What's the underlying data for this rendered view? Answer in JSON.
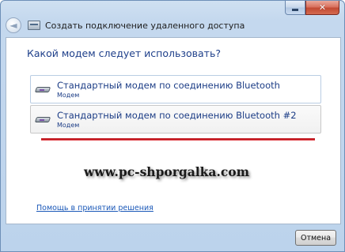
{
  "window": {
    "title": "Создать подключение удаленного доступа",
    "close_glyph": "✕"
  },
  "header": {
    "back_glyph": "◄"
  },
  "main": {
    "question": "Какой модем следует использовать?",
    "options": [
      {
        "title": "Стандартный модем по соединению Bluetooth",
        "subtitle": "Модем",
        "icon": "modem-icon"
      },
      {
        "title": "Стандартный модем по соединению Bluetooth #2",
        "subtitle": "Модем",
        "icon": "modem-icon"
      }
    ],
    "watermark": "www.pc-shporgalka.com",
    "help_link": "Помощь в принятии решения"
  },
  "footer": {
    "cancel_label": "Отмена"
  },
  "colors": {
    "link": "#1a58b8",
    "heading": "#1e3f8a",
    "annotation_line": "#c0141c"
  }
}
